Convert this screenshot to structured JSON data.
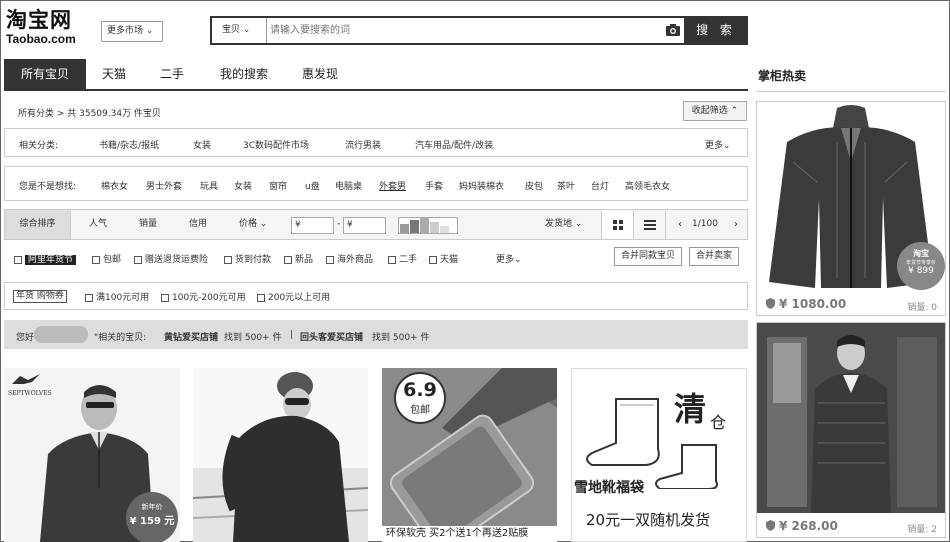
{
  "header": {
    "logo_cn": "淘宝网",
    "logo_en": "Taobao.com",
    "market_label": "更多市场 ⌄",
    "search_category": "宝贝  ⌄",
    "search_placeholder": "请输入要搜索的词",
    "search_button": "搜 索"
  },
  "tabs": [
    "所有宝贝",
    "天猫",
    "二手",
    "我的搜索",
    "惠发现"
  ],
  "sidebar_title": "掌柜热卖",
  "breadcrumb": "所有分类 >  共 35509.34万 件宝贝",
  "collapse_label": "收起筛选 ⌃",
  "related": {
    "label": "相关分类:",
    "items": [
      "书籍/杂志/报纸",
      "女装",
      "3C数码配件市场",
      "流行男装",
      "汽车用品/配件/改装"
    ],
    "more": "更多⌄"
  },
  "want": {
    "label": "您是不是想找:",
    "items": [
      "棉衣女",
      "男士外套",
      "玩具",
      "女装",
      "窗帘",
      "u盘",
      "电脑桌",
      "外套男",
      "手套",
      "妈妈装棉衣",
      "皮包",
      "茶叶",
      "台灯",
      "高领毛衣女"
    ]
  },
  "sort": {
    "items": [
      "综合排序",
      "人气",
      "销量",
      "信用",
      "价格 ⌄"
    ],
    "price_from": "¥",
    "price_to": "¥",
    "dash": "-",
    "ship_from": "发货地 ⌄",
    "pagination": "1/100"
  },
  "filters": {
    "items": [
      "阿里年货节",
      "包邮",
      "赠送退货运费险",
      "货到付款",
      "新品",
      "海外商品",
      "二手",
      "天猫"
    ],
    "more": "更多⌄",
    "merge_same": "合并同款宝贝",
    "merge_sellers": "合并卖家"
  },
  "promo": {
    "tag": "年货 购物券",
    "items": [
      "满100元可用",
      "100元-200元可用",
      "200元以上可用"
    ]
  },
  "notice": {
    "greeting": "您好",
    "prefix": "\"相关的宝贝:",
    "shop1": "黄钻爱买店铺",
    "found1": "找到 500+ 件",
    "divider": "|",
    "shop2": "回头客爱买店铺",
    "found2": "找到 500+ 件"
  },
  "products": [
    {
      "brand": "SEPTWOLVES",
      "badge_line1": "新年价",
      "badge_price": "¥ 159 元"
    },
    {},
    {
      "badge_big": "6.9",
      "badge_small": "包邮",
      "caption": "环保软壳  买2个送1个再送2贴膜"
    },
    {
      "title_char": "清",
      "title_small": "仓",
      "line1": "雪地靴福袋",
      "line2": "20元一双随机发货"
    }
  ],
  "side_products": [
    {
      "badge1": "淘宝",
      "badge2": "年货节专享价",
      "badge_price": "¥ 899",
      "price": "¥ 1080.00",
      "sales": "销量: 0"
    },
    {
      "price": "¥ 268.00",
      "sales": "销量: 2"
    }
  ]
}
